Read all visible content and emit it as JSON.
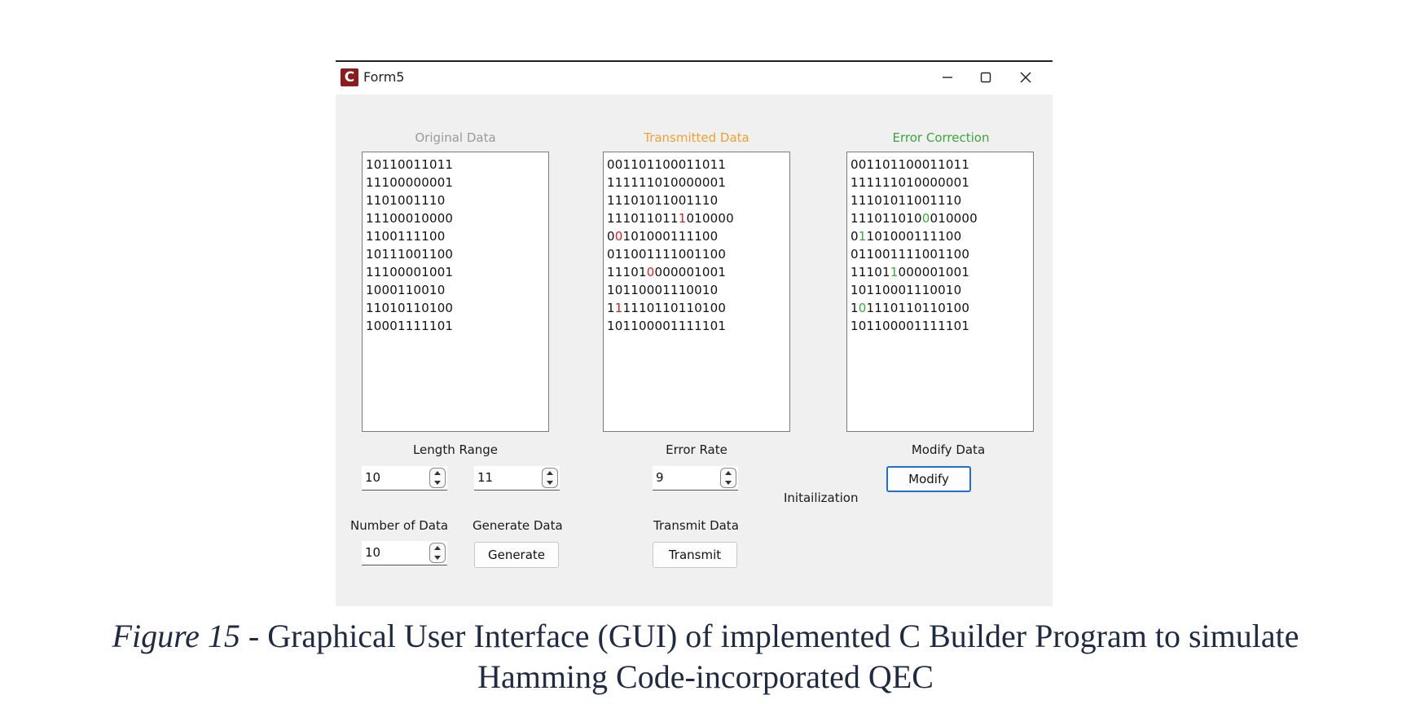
{
  "window": {
    "title": "Form5",
    "app_icon_letter": "C"
  },
  "columns": {
    "original": {
      "header": "Original Data",
      "header_color": "#9a9a9a",
      "lines": [
        "10110011011",
        "11100000001",
        "1101001110",
        "11100010000",
        "1100111100",
        "10111001100",
        "11100001001",
        "1000110010",
        "11010110100",
        "10001111101"
      ]
    },
    "transmitted": {
      "header": "Transmitted Data",
      "header_color": "#f0a030",
      "lines": [
        {
          "a": "001101100011011",
          "m": "",
          "b": ""
        },
        {
          "a": "111111010000001",
          "m": "",
          "b": ""
        },
        {
          "a": "11101011001110",
          "m": "",
          "b": ""
        },
        {
          "a": "111011011",
          "m": "1",
          "b": "010000"
        },
        {
          "a": "0",
          "m": "0",
          "b": "101000111100"
        },
        {
          "a": "011001111001100",
          "m": "",
          "b": ""
        },
        {
          "a": "11101",
          "m": "0",
          "b": "000001001"
        },
        {
          "a": "10110001110010",
          "m": "",
          "b": ""
        },
        {
          "a": "1",
          "m": "1",
          "b": "1110110110100"
        },
        {
          "a": "101100001111101",
          "m": "",
          "b": ""
        }
      ]
    },
    "corrected": {
      "header": "Error Correction",
      "header_color": "#3aa53a",
      "lines": [
        {
          "a": "001101100011011",
          "m": "",
          "b": ""
        },
        {
          "a": "111111010000001",
          "m": "",
          "b": ""
        },
        {
          "a": "11101011001110",
          "m": "",
          "b": ""
        },
        {
          "a": "111011010",
          "m": "0",
          "b": "010000"
        },
        {
          "a": "0",
          "m": "1",
          "b": "101000111100"
        },
        {
          "a": "011001111001100",
          "m": "",
          "b": ""
        },
        {
          "a": "11101",
          "m": "1",
          "b": "000001001"
        },
        {
          "a": "10110001110010",
          "m": "",
          "b": ""
        },
        {
          "a": "1",
          "m": "0",
          "b": "1110110110100"
        },
        {
          "a": "101100001111101",
          "m": "",
          "b": ""
        }
      ]
    }
  },
  "controls": {
    "length_range_label": "Length Range",
    "length_min": "10",
    "length_max": "11",
    "error_rate_label": "Error Rate",
    "error_rate": "9",
    "modify_label": "Modify Data",
    "modify_button": "Modify",
    "init_label": "Initailization",
    "num_data_label": "Number of Data",
    "num_data": "10",
    "generate_label": "Generate Data",
    "generate_button": "Generate",
    "transmit_label": "Transmit Data",
    "transmit_button": "Transmit"
  },
  "caption": {
    "figure": "Figure 15",
    "text": " - Graphical User Interface (GUI) of implemented C Builder Program to simulate",
    "line2": "Hamming Code-incorporated QEC"
  },
  "icons": [
    "app-icon",
    "minimize-icon",
    "maximize-icon",
    "close-icon",
    "spin-up-icon",
    "spin-down-icon"
  ]
}
